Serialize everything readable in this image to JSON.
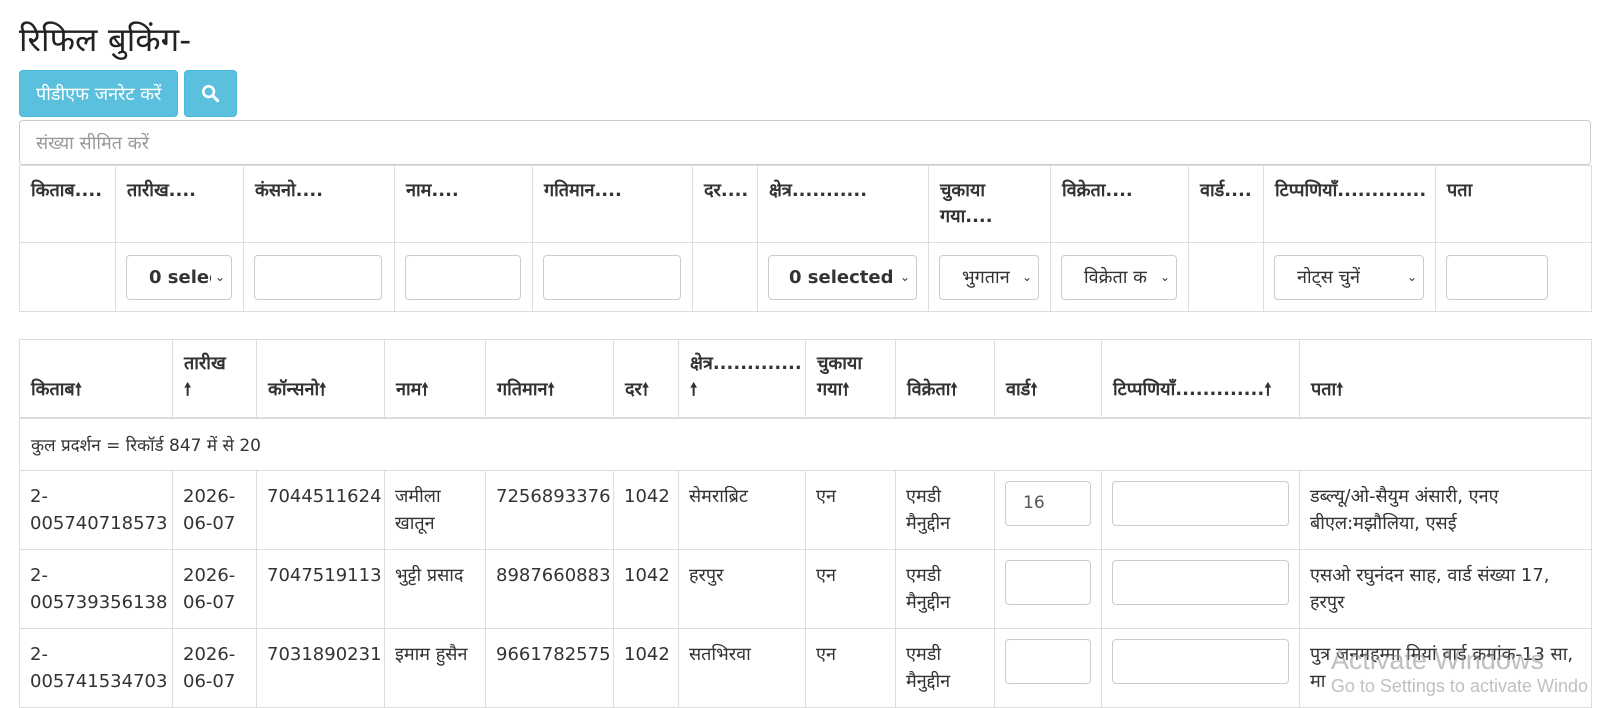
{
  "page_title": "रिफिल बुकिंग-",
  "toolbar": {
    "pdf_button": "पीडीएफ जनरेट करें",
    "search_icon": "search-icon"
  },
  "limit_input": {
    "placeholder": "संख्या सीमित करें"
  },
  "filter_headers": [
    "किताब....",
    "तारीख....",
    "कंसनो....",
    "नाम....",
    "गतिमान....",
    "दर....",
    "क्षेत्र...........",
    "चुकाया गया....",
    "विक्रेता....",
    "वार्ड....",
    "टिप्पणियाँ.............",
    "पता"
  ],
  "filters": {
    "date": "0 selec",
    "area": "0 selected",
    "paid": "भुगतान",
    "vendor": "विक्रेता क",
    "notes": "नोट्स चुनें"
  },
  "main_headers": [
    "किताब",
    "तारीख",
    "कॉन्सनो",
    "नाम",
    "गतिमान",
    "दर",
    "क्षेत्र.............",
    "चुकाया गया",
    "विक्रेता",
    "वार्ड",
    "टिप्पणियाँ.............",
    "पता"
  ],
  "summary": "कुल प्रदर्शन = रिकॉर्ड 847 में से 20",
  "rows": [
    {
      "book": "2-005740718573",
      "date": "2026-06-07",
      "consno": "7044511624",
      "name": "जमीला खातून",
      "mobile": "7256893376",
      "rate": "1042",
      "area": "सेमराब्रिट",
      "paid": "एन",
      "vendor": "एमडी मैनुद्दीन",
      "ward": "16",
      "notes": "",
      "address": "डब्ल्यू/ओ-सैयुम अंसारी, एनए बीएल:मझौलिया, एसई"
    },
    {
      "book": "2-005739356138",
      "date": "2026-06-07",
      "consno": "7047519113",
      "name": "भुट्टी प्रसाद",
      "mobile": "8987660883",
      "rate": "1042",
      "area": "हरपुर",
      "paid": "एन",
      "vendor": "एमडी मैनुद्दीन",
      "ward": "",
      "notes": "",
      "address": "एसओ रघुनंदन साह, वार्ड संख्या 17, हरपुर"
    },
    {
      "book": "2-005741534703",
      "date": "2026-06-07",
      "consno": "7031890231",
      "name": "इमाम हुसैन",
      "mobile": "9661782575",
      "rate": "1042",
      "area": "सतभिरवा",
      "paid": "एन",
      "vendor": "एमडी मैनुद्दीन",
      "ward": "",
      "notes": "",
      "address": "पुत्र जनमहम्मा मियां वार्ड क्रमांक-13 सा, मा"
    }
  ],
  "watermark": {
    "line1": "Activate Windows",
    "line2": "Go to Settings to activate Windo"
  },
  "colors": {
    "button": "#5bc0de",
    "border": "#dddddd"
  }
}
